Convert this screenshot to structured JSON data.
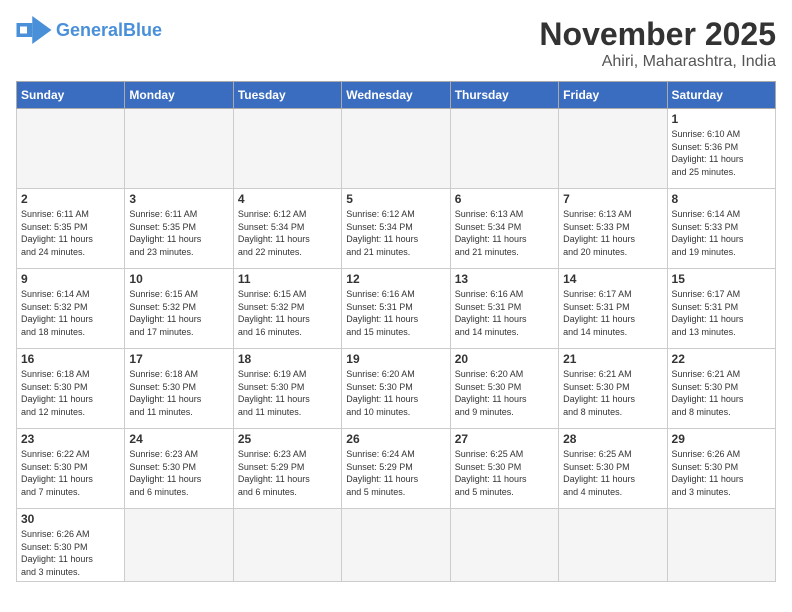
{
  "header": {
    "logo_general": "General",
    "logo_blue": "Blue",
    "month": "November 2025",
    "location": "Ahiri, Maharashtra, India"
  },
  "weekdays": [
    "Sunday",
    "Monday",
    "Tuesday",
    "Wednesday",
    "Thursday",
    "Friday",
    "Saturday"
  ],
  "weeks": [
    [
      {
        "day": "",
        "info": ""
      },
      {
        "day": "",
        "info": ""
      },
      {
        "day": "",
        "info": ""
      },
      {
        "day": "",
        "info": ""
      },
      {
        "day": "",
        "info": ""
      },
      {
        "day": "",
        "info": ""
      },
      {
        "day": "1",
        "info": "Sunrise: 6:10 AM\nSunset: 5:36 PM\nDaylight: 11 hours\nand 25 minutes."
      }
    ],
    [
      {
        "day": "2",
        "info": "Sunrise: 6:11 AM\nSunset: 5:35 PM\nDaylight: 11 hours\nand 24 minutes."
      },
      {
        "day": "3",
        "info": "Sunrise: 6:11 AM\nSunset: 5:35 PM\nDaylight: 11 hours\nand 23 minutes."
      },
      {
        "day": "4",
        "info": "Sunrise: 6:12 AM\nSunset: 5:34 PM\nDaylight: 11 hours\nand 22 minutes."
      },
      {
        "day": "5",
        "info": "Sunrise: 6:12 AM\nSunset: 5:34 PM\nDaylight: 11 hours\nand 21 minutes."
      },
      {
        "day": "6",
        "info": "Sunrise: 6:13 AM\nSunset: 5:34 PM\nDaylight: 11 hours\nand 21 minutes."
      },
      {
        "day": "7",
        "info": "Sunrise: 6:13 AM\nSunset: 5:33 PM\nDaylight: 11 hours\nand 20 minutes."
      },
      {
        "day": "8",
        "info": "Sunrise: 6:14 AM\nSunset: 5:33 PM\nDaylight: 11 hours\nand 19 minutes."
      }
    ],
    [
      {
        "day": "9",
        "info": "Sunrise: 6:14 AM\nSunset: 5:32 PM\nDaylight: 11 hours\nand 18 minutes."
      },
      {
        "day": "10",
        "info": "Sunrise: 6:15 AM\nSunset: 5:32 PM\nDaylight: 11 hours\nand 17 minutes."
      },
      {
        "day": "11",
        "info": "Sunrise: 6:15 AM\nSunset: 5:32 PM\nDaylight: 11 hours\nand 16 minutes."
      },
      {
        "day": "12",
        "info": "Sunrise: 6:16 AM\nSunset: 5:31 PM\nDaylight: 11 hours\nand 15 minutes."
      },
      {
        "day": "13",
        "info": "Sunrise: 6:16 AM\nSunset: 5:31 PM\nDaylight: 11 hours\nand 14 minutes."
      },
      {
        "day": "14",
        "info": "Sunrise: 6:17 AM\nSunset: 5:31 PM\nDaylight: 11 hours\nand 14 minutes."
      },
      {
        "day": "15",
        "info": "Sunrise: 6:17 AM\nSunset: 5:31 PM\nDaylight: 11 hours\nand 13 minutes."
      }
    ],
    [
      {
        "day": "16",
        "info": "Sunrise: 6:18 AM\nSunset: 5:30 PM\nDaylight: 11 hours\nand 12 minutes."
      },
      {
        "day": "17",
        "info": "Sunrise: 6:18 AM\nSunset: 5:30 PM\nDaylight: 11 hours\nand 11 minutes."
      },
      {
        "day": "18",
        "info": "Sunrise: 6:19 AM\nSunset: 5:30 PM\nDaylight: 11 hours\nand 11 minutes."
      },
      {
        "day": "19",
        "info": "Sunrise: 6:20 AM\nSunset: 5:30 PM\nDaylight: 11 hours\nand 10 minutes."
      },
      {
        "day": "20",
        "info": "Sunrise: 6:20 AM\nSunset: 5:30 PM\nDaylight: 11 hours\nand 9 minutes."
      },
      {
        "day": "21",
        "info": "Sunrise: 6:21 AM\nSunset: 5:30 PM\nDaylight: 11 hours\nand 8 minutes."
      },
      {
        "day": "22",
        "info": "Sunrise: 6:21 AM\nSunset: 5:30 PM\nDaylight: 11 hours\nand 8 minutes."
      }
    ],
    [
      {
        "day": "23",
        "info": "Sunrise: 6:22 AM\nSunset: 5:30 PM\nDaylight: 11 hours\nand 7 minutes."
      },
      {
        "day": "24",
        "info": "Sunrise: 6:23 AM\nSunset: 5:30 PM\nDaylight: 11 hours\nand 6 minutes."
      },
      {
        "day": "25",
        "info": "Sunrise: 6:23 AM\nSunset: 5:29 PM\nDaylight: 11 hours\nand 6 minutes."
      },
      {
        "day": "26",
        "info": "Sunrise: 6:24 AM\nSunset: 5:29 PM\nDaylight: 11 hours\nand 5 minutes."
      },
      {
        "day": "27",
        "info": "Sunrise: 6:25 AM\nSunset: 5:30 PM\nDaylight: 11 hours\nand 5 minutes."
      },
      {
        "day": "28",
        "info": "Sunrise: 6:25 AM\nSunset: 5:30 PM\nDaylight: 11 hours\nand 4 minutes."
      },
      {
        "day": "29",
        "info": "Sunrise: 6:26 AM\nSunset: 5:30 PM\nDaylight: 11 hours\nand 3 minutes."
      }
    ],
    [
      {
        "day": "30",
        "info": "Sunrise: 6:26 AM\nSunset: 5:30 PM\nDaylight: 11 hours\nand 3 minutes."
      },
      {
        "day": "",
        "info": ""
      },
      {
        "day": "",
        "info": ""
      },
      {
        "day": "",
        "info": ""
      },
      {
        "day": "",
        "info": ""
      },
      {
        "day": "",
        "info": ""
      },
      {
        "day": "",
        "info": ""
      }
    ]
  ]
}
